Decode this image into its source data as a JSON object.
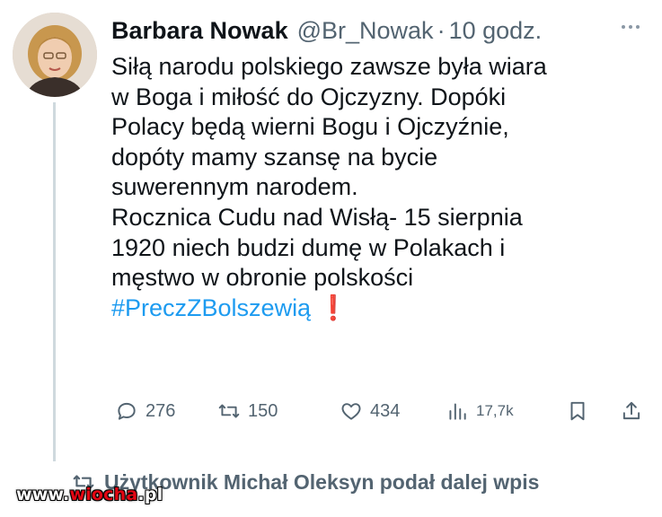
{
  "tweet": {
    "author_name": "Barbara Nowak",
    "author_handle": "@Br_Nowak",
    "separator": "·",
    "time": "10 godz.",
    "lines": [
      "Siłą narodu polskiego zawsze była wiara",
      "w Boga i miłość do Ojczyzny. Dopóki",
      "Polacy będą wierni Bogu i Ojczyźnie,",
      "dopóty mamy szansę na bycie",
      "suwerennym narodem.",
      "Rocznica Cudu nad Wisłą- 15 sierpnia",
      "1920 niech budzi dumę w Polakach i",
      "męstwo w obronie polskości"
    ],
    "hashtag": "#PreczZBolszewią",
    "emoji": "❗"
  },
  "stats": {
    "replies": "276",
    "reposts": "150",
    "likes": "434",
    "views": "17,7k"
  },
  "repost_notice": "Użytkownik Michał Oleksyn podał dalej wpis",
  "watermark": {
    "prefix": "www.",
    "brand": "wiocha",
    "suffix": ".pl"
  },
  "icons": [
    "avatar",
    "more-icon",
    "reply-icon",
    "repost-icon",
    "like-icon",
    "views-icon",
    "bookmark-icon",
    "share-icon"
  ],
  "colors": {
    "text": "#0f1419",
    "secondary": "#536471",
    "hashtag": "#1d9bf0",
    "exclamation": "#e0272f"
  }
}
